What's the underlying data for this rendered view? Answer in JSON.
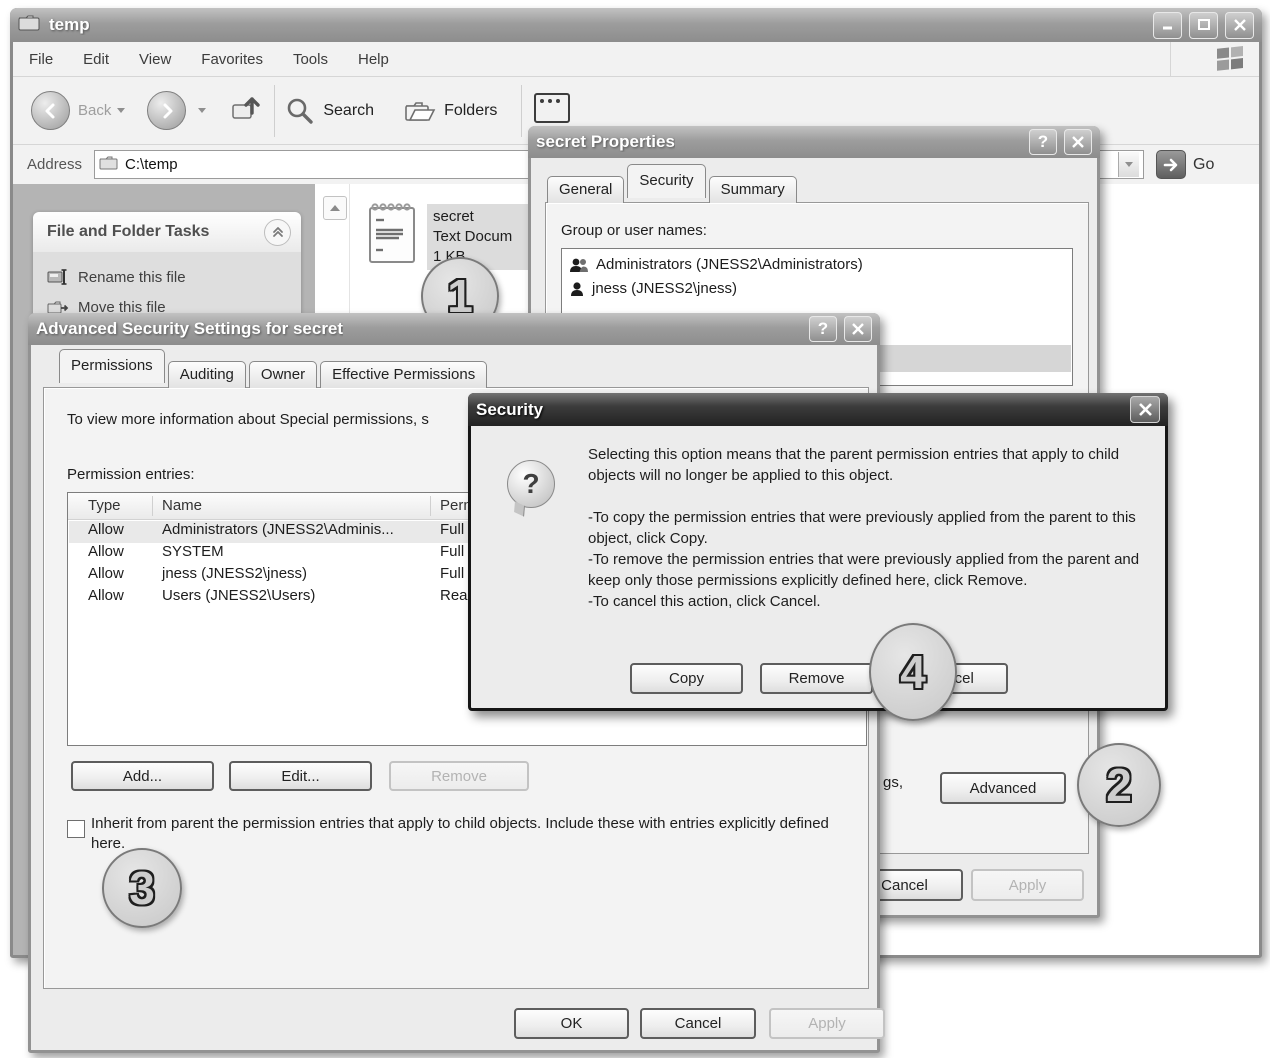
{
  "explorer": {
    "title": "temp",
    "menu": [
      "File",
      "Edit",
      "View",
      "Favorites",
      "Tools",
      "Help"
    ],
    "toolbar": {
      "back_label": "Back",
      "search_label": "Search",
      "folders_label": "Folders"
    },
    "address": {
      "label": "Address",
      "value": "C:\\temp",
      "go_label": "Go"
    },
    "taskpanel": {
      "title": "File and Folder Tasks",
      "items": [
        "Rename this file",
        "Move this file"
      ]
    },
    "file": {
      "name": "secret",
      "type_fragment": "Text Docum",
      "size": "1 KB"
    }
  },
  "properties": {
    "title": "secret Properties",
    "tabs": [
      "General",
      "Security",
      "Summary"
    ],
    "group_label": "Group or user names:",
    "groups": [
      "Administrators (JNESS2\\Administrators)",
      "jness (JNESS2\\jness)"
    ],
    "advanced_text_fragment": "gs,",
    "advanced_button": "Advanced",
    "cancel_button": "Cancel",
    "apply_button": "Apply"
  },
  "advanced": {
    "title": "Advanced Security Settings for secret",
    "tabs": [
      "Permissions",
      "Auditing",
      "Owner",
      "Effective Permissions"
    ],
    "info_fragment": "To view more information about Special permissions, s",
    "entries_label": "Permission entries:",
    "table": {
      "headers": {
        "type": "Type",
        "name": "Name",
        "perm": "Perm"
      },
      "rows": [
        {
          "type": "Allow",
          "name": "Administrators (JNESS2\\Adminis...",
          "perm": "Full C"
        },
        {
          "type": "Allow",
          "name": "SYSTEM",
          "perm": "Full C"
        },
        {
          "type": "Allow",
          "name": "jness (JNESS2\\jness)",
          "perm": "Full C"
        },
        {
          "type": "Allow",
          "name": "Users (JNESS2\\Users)",
          "perm": "Reac"
        }
      ]
    },
    "add_button": "Add...",
    "edit_button": "Edit...",
    "remove_button": "Remove",
    "inherit_label": "Inherit from parent the permission entries that apply to child objects. Include these with entries explicitly defined here.",
    "ok_button": "OK",
    "cancel_button": "Cancel",
    "apply_button": "Apply"
  },
  "security_msg": {
    "title": "Security",
    "p1": "Selecting this option means that the parent permission entries that apply to child objects will no longer be applied to this object.",
    "p2": "-To copy  the permission entries that were previously applied from the parent to this object, click Copy.",
    "p3": "-To remove the permission entries that were previously applied from the parent and keep only those permissions explicitly defined here, click Remove.",
    "p4": "-To cancel this action, click Cancel.",
    "copy_button": "Copy",
    "remove_button": "Remove",
    "cancel_button": "Cancel"
  },
  "callouts": {
    "c1": "1",
    "c2": "2",
    "c3": "3",
    "c4": "4"
  }
}
